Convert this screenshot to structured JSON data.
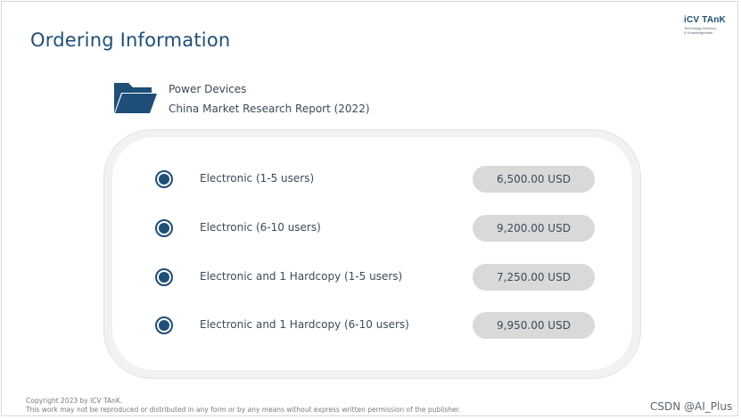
{
  "header": {
    "title": "Ordering Information",
    "logo": {
      "brand": "iCV TAnK",
      "tagline_line1": "Technology Advisory",
      "tagline_line2": "& Knowledgebase"
    }
  },
  "product": {
    "icon": "folder-icon",
    "line1": "Power Devices",
    "line2": "China Market Research Report (2022)"
  },
  "options": [
    {
      "label": "Electronic (1-5 users)",
      "price": "6,500.00 USD"
    },
    {
      "label": "Electronic (6-10 users)",
      "price": "9,200.00 USD"
    },
    {
      "label": "Electronic and 1 Hardcopy (1-5 users)",
      "price": "7,250.00 USD"
    },
    {
      "label": "Electronic and 1 Hardcopy (6-10 users)",
      "price": "9,950.00 USD"
    }
  ],
  "footer": {
    "copyright": "Copyright  2023 by ICV TAnK.",
    "notice": "This work may not be reproduced or distributed in any form or by any means without express written permission of the publisher."
  },
  "watermark": "CSDN @AI_Plus",
  "colors": {
    "accent": "#1f4e79",
    "pill": "#d9d9d9",
    "text": "#3b4b5a"
  }
}
